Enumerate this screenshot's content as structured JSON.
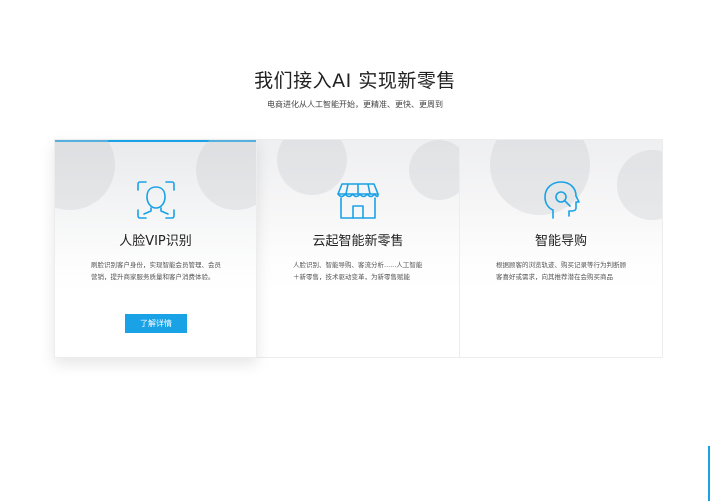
{
  "header": {
    "title": "我们接入AI 实现新零售",
    "subtitle": "电商进化从人工智能开始，更精准、更快、更周到"
  },
  "colors": {
    "accent": "#1aa2e6",
    "icon": "#1aa2e6"
  },
  "cards": [
    {
      "icon": "face-recognition-icon",
      "title": "人脸VIP识别",
      "desc": "刷脸识别客户身份，实现智能会员管理、会员营销，提升商家服务质量和客户消费体验。",
      "button": "了解详情"
    },
    {
      "icon": "storefront-icon",
      "title": "云起智能新零售",
      "desc": "人脸识别、智能导购、客流分析......人工智能＋新零售，技术驱动变革，为新零售赋能"
    },
    {
      "icon": "smart-guide-icon",
      "title": "智能导购",
      "desc": "根据顾客的浏览轨迹、购买记录等行为判断顾客喜好或需求，向其推荐潜在会购买商品"
    }
  ]
}
